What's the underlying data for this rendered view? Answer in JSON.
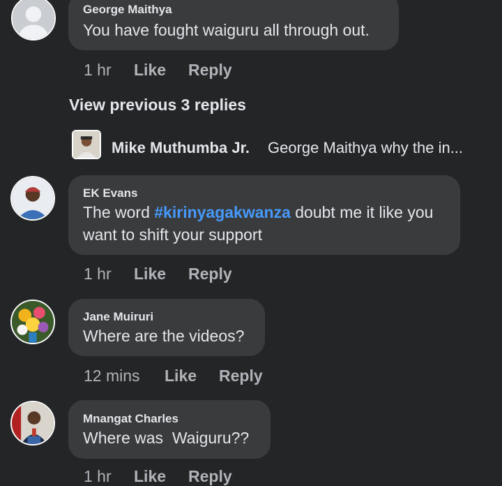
{
  "comments": [
    {
      "author": "George Maithya",
      "text": "You have fought waiguru all through out.",
      "time": "1 hr",
      "like": "Like",
      "reply": "Reply"
    },
    {
      "author": "EK Evans",
      "text_before": "The word ",
      "hashtag": "#kirinyagakwanza",
      "text_after": " doubt me it like you",
      "text_line2": "want to shift your support",
      "time": "1 hr",
      "like": "Like",
      "reply": "Reply"
    },
    {
      "author": "Jane Muiruri",
      "text": "Where are the videos?",
      "time": "12 mins",
      "like": "Like",
      "reply": "Reply"
    },
    {
      "author": "Mnangat Charles",
      "text": "Where was  Waiguru??",
      "time": "1 hr",
      "like": "Like",
      "reply": "Reply"
    }
  ],
  "thread": {
    "view_previous": "View previous 3 replies",
    "latest_reply_author": "Mike Muthumba Jr.",
    "latest_reply_text": "George Maithya why the in..."
  },
  "colors": {
    "background": "#242526",
    "bubble": "#3a3b3c",
    "hashtag": "#4599ff",
    "muted_text": "#b0b3b8"
  }
}
